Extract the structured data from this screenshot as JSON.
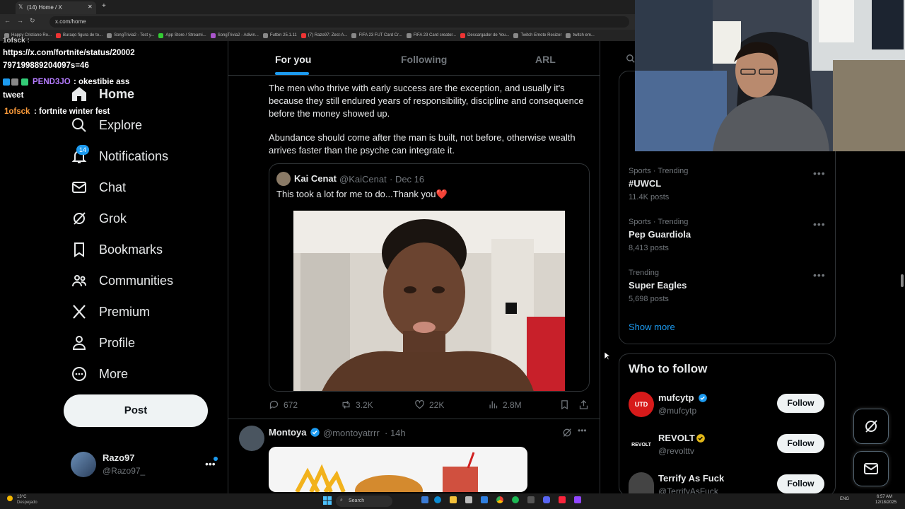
{
  "browser": {
    "tab_title": "(14) Home / X",
    "url": "x.com/home",
    "bookmarks": [
      "Happy Cristiano Ro...",
      "Buraqo figura de to...",
      "SongTrivia2 - Test y...",
      "App Store / Streami...",
      "SongTrivia2 - Adivin...",
      "Futbin 25.1.11",
      "(7) Razo97: Zest-A...",
      "FIFA 23 FUT Card Cr...",
      "FIFA 23 Card creator...",
      "Descargador de You...",
      "Twitch Emote Resizer",
      "twitch em..."
    ]
  },
  "chat_overlay": {
    "cut_line": "1ofsck :",
    "line1_url_a": "https://x.com/fortnite/status/20002",
    "line1_url_b": "797199889204097s=46",
    "line2_user": "PEND3JO",
    "line2_msg_a": ": okestibie ass",
    "line2_msg_b": "tweet",
    "line3_user": "1ofsck",
    "line3_msg": ": fortnite winter fest"
  },
  "nav": {
    "home": "Home",
    "explore": "Explore",
    "notifications": "Notifications",
    "notifications_badge": "14",
    "chat": "Chat",
    "grok": "Grok",
    "bookmarks": "Bookmarks",
    "communities": "Communities",
    "premium": "Premium",
    "profile": "Profile",
    "more": "More",
    "post": "Post"
  },
  "account": {
    "name": "Razo97",
    "handle": "@Razo97_"
  },
  "feed_tabs": {
    "for_you": "For you",
    "following": "Following",
    "arl": "ARL"
  },
  "tweet1": {
    "para1": "The men who thrive with early success are the exception, and usually it's because they still endured years of responsibility, discipline and consequence before the money showed up.",
    "para2": "Abundance should come after the man is built, not before, otherwise wealth arrives faster than the psyche can integrate it.",
    "quote": {
      "name": "Kai Cenat",
      "handle": "@KaiCenat",
      "date": "· Dec 16",
      "text": "This took a lot for me to do...Thank you",
      "heart": "❤️"
    },
    "replies": "672",
    "reposts": "3.2K",
    "likes": "22K",
    "views": "2.8M"
  },
  "tweet2": {
    "name": "Montoya",
    "handle": "@montoyatrrr",
    "time": "· 14h"
  },
  "trends": [
    {
      "meta": "Sports · Trending",
      "name": "#UWCL",
      "posts": "11.4K posts"
    },
    {
      "meta": "Sports · Trending",
      "name": "Pep Guardiola",
      "posts": "8,413 posts"
    },
    {
      "meta": "Trending",
      "name": "Super Eagles",
      "posts": "5,698 posts"
    }
  ],
  "show_more": "Show more",
  "who_to_follow": {
    "title": "Who to follow",
    "follow_label": "Follow",
    "accounts": [
      {
        "name": "mufcytp",
        "handle": "@mufcytp"
      },
      {
        "name": "REVOLT",
        "handle": "@revolttv"
      },
      {
        "name": "Terrify As Fuck",
        "handle": "@TerrifyAsFuck"
      }
    ]
  },
  "taskbar": {
    "weather_temp": "13°C",
    "weather_desc": "Despejado",
    "search": "Search",
    "lang": "ENG",
    "time": "6:57 AM",
    "date": "12/18/2025"
  },
  "colors": {
    "accent": "#1d9bf0",
    "bg": "#000000",
    "border": "#2f3336",
    "muted": "#71767b"
  }
}
